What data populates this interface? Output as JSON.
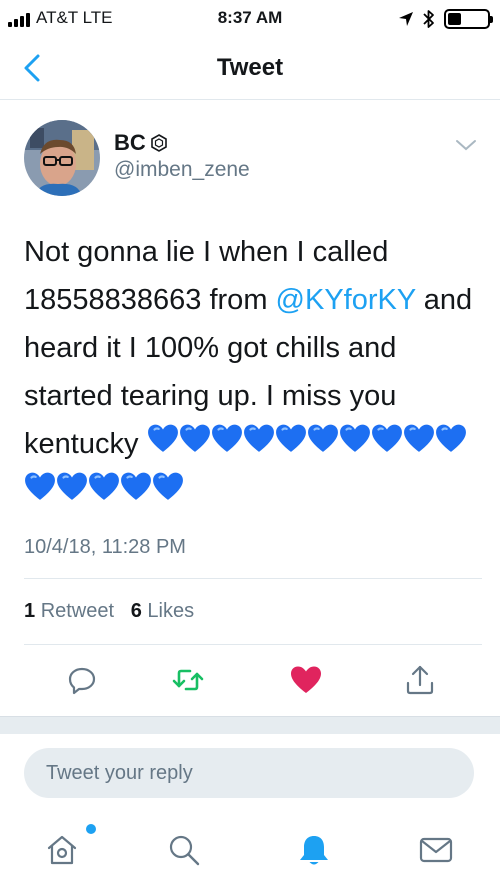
{
  "status_bar": {
    "carrier": "AT&T  LTE",
    "time": "8:37 AM",
    "signal_bars": 4,
    "battery_level": 0.35
  },
  "nav": {
    "title": "Tweet",
    "back_icon": "chevron-left-icon"
  },
  "tweet": {
    "display_name": "BC",
    "handle": "@imben_zene",
    "text_part1": "Not gonna lie I when I called 18558838663 from ",
    "mention": "@KYforKY",
    "text_part2": " and heard it I 100% got chills and started tearing up. I miss you kentucky ",
    "blue_heart_count": 15,
    "timestamp": "10/4/18, 11:28 PM",
    "retweet_count": "1",
    "retweet_label": "Retweet",
    "like_count": "6",
    "like_label": "Likes"
  },
  "actions": [
    "reply-icon",
    "retweet-icon",
    "like-icon",
    "share-icon"
  ],
  "reply": {
    "placeholder": "Tweet your reply"
  },
  "tab_bar": [
    "home-icon",
    "search-icon",
    "notifications-icon",
    "messages-icon"
  ],
  "colors": {
    "accent": "#1da1f2",
    "retweet": "#17bf63",
    "like": "#e0245e",
    "muted": "#657786"
  }
}
